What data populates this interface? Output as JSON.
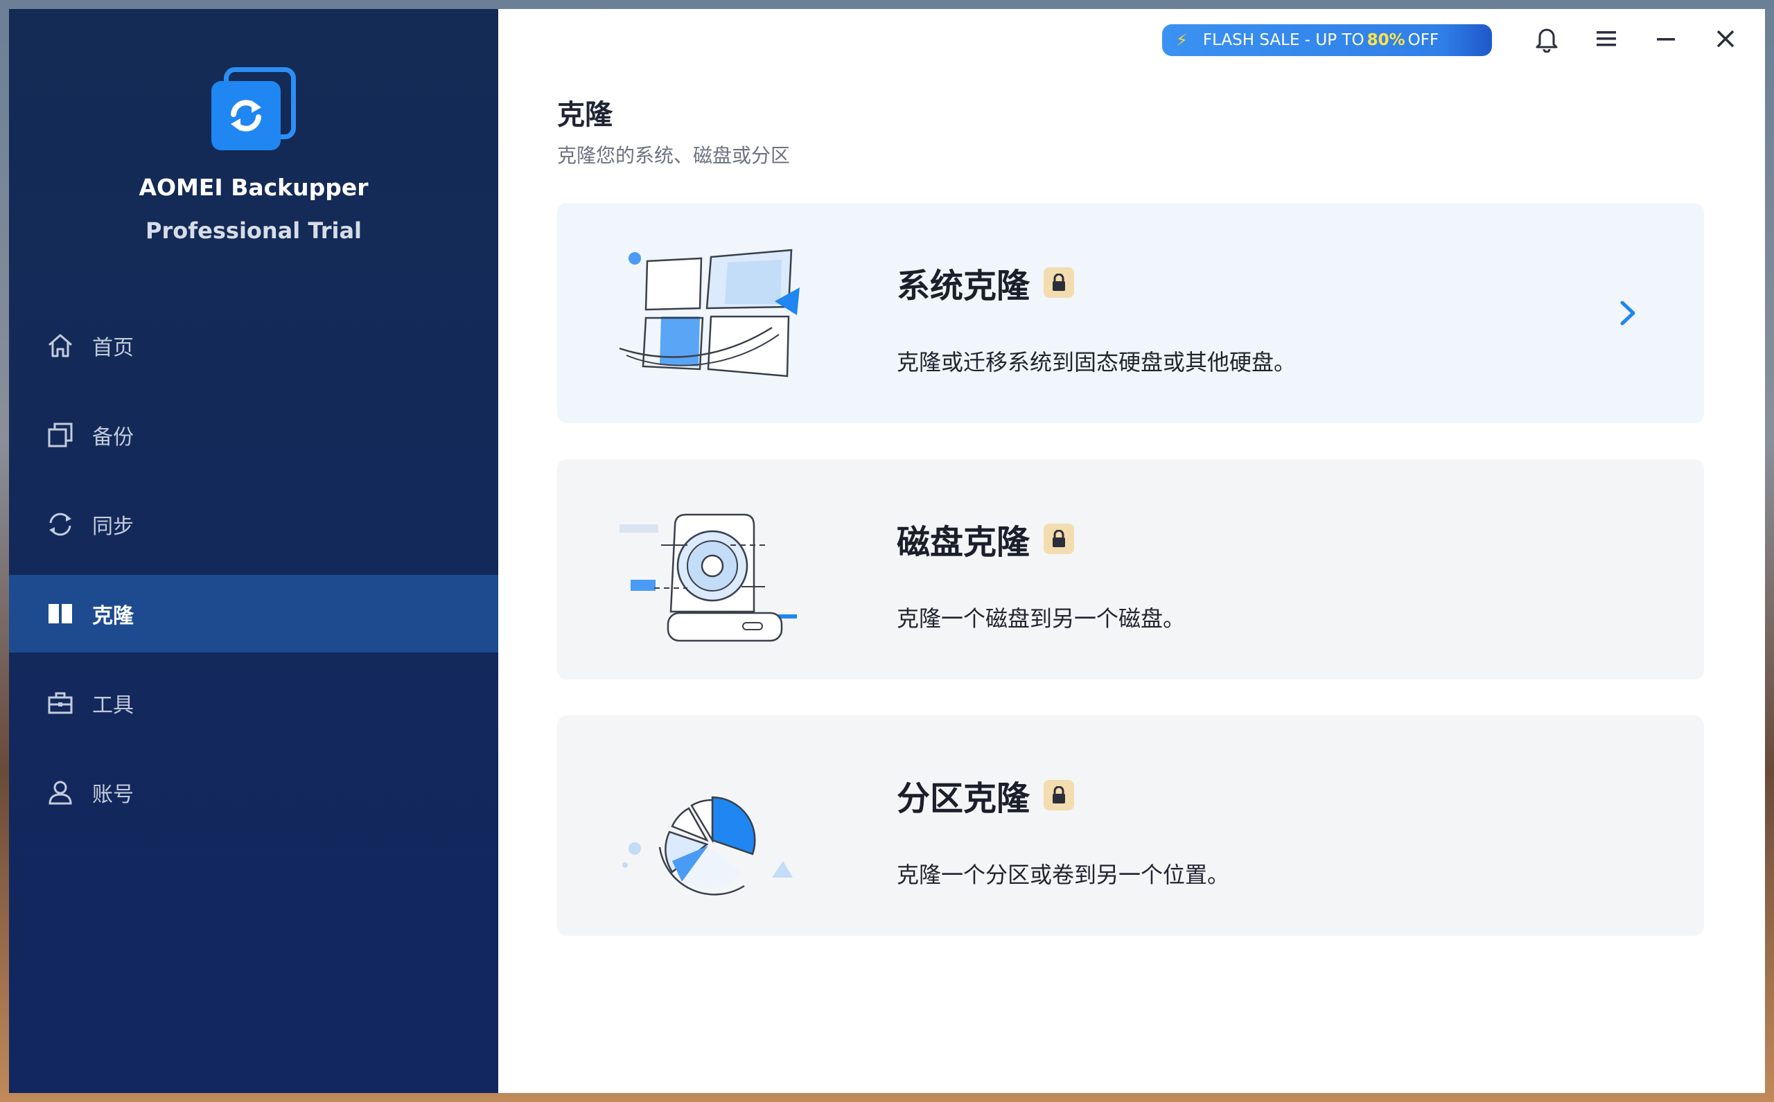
{
  "app": {
    "name": "AOMEI Backupper",
    "edition": "Professional Trial"
  },
  "sidebar": {
    "items": [
      {
        "label": "首页",
        "icon": "home-icon",
        "active": false
      },
      {
        "label": "备份",
        "icon": "backup-icon",
        "active": false
      },
      {
        "label": "同步",
        "icon": "sync-icon",
        "active": false
      },
      {
        "label": "克隆",
        "icon": "clone-icon",
        "active": true
      },
      {
        "label": "工具",
        "icon": "toolbox-icon",
        "active": false
      },
      {
        "label": "账号",
        "icon": "user-icon",
        "active": false
      }
    ]
  },
  "topbar": {
    "flash_prefix": "FLASH SALE - UP TO",
    "flash_percent": "80%",
    "flash_suffix": "OFF"
  },
  "page": {
    "title": "克隆",
    "subtitle": "克隆您的系统、磁盘或分区"
  },
  "cards": [
    {
      "title": "系统克隆",
      "description": "克隆或迁移系统到固态硬盘或其他硬盘。",
      "locked": true
    },
    {
      "title": "磁盘克隆",
      "description": "克隆一个磁盘到另一个磁盘。",
      "locked": true
    },
    {
      "title": "分区克隆",
      "description": "克隆一个分区或卷到另一个位置。",
      "locked": true
    }
  ],
  "colors": {
    "sidebar_bg": "#142b55",
    "active_item": "#1e4b8f",
    "accent": "#1f86f2",
    "lock_badge": "#f3ddb0"
  }
}
